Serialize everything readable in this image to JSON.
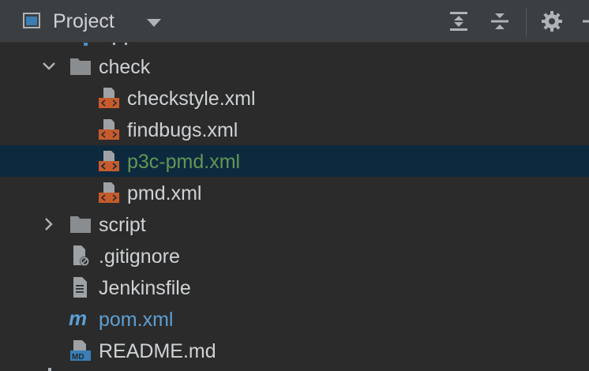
{
  "header": {
    "title": "Project",
    "icons": [
      "project-view-icon",
      "dropdown-chevron-icon",
      "expand-all-icon",
      "collapse-all-icon",
      "gear-icon",
      "hide-icon"
    ]
  },
  "tree": {
    "rows": [
      {
        "label": "check",
        "kind": "folder",
        "expanded": true
      },
      {
        "label": "checkstyle.xml",
        "kind": "xml"
      },
      {
        "label": "findbugs.xml",
        "kind": "xml"
      },
      {
        "label": "p3c-pmd.xml",
        "kind": "xml",
        "selected": true
      },
      {
        "label": "pmd.xml",
        "kind": "xml"
      },
      {
        "label": "script",
        "kind": "folder",
        "expanded": false
      },
      {
        "label": ".gitignore",
        "kind": "ignore"
      },
      {
        "label": "Jenkinsfile",
        "kind": "text"
      },
      {
        "label": "pom.xml",
        "kind": "maven"
      },
      {
        "label": "README.md",
        "kind": "markdown"
      }
    ]
  },
  "colors": {
    "selected_row": "#0d293e",
    "selected_text": "#629755",
    "maven_text": "#5d9fd3",
    "xml_badge": "#c75b2c"
  }
}
